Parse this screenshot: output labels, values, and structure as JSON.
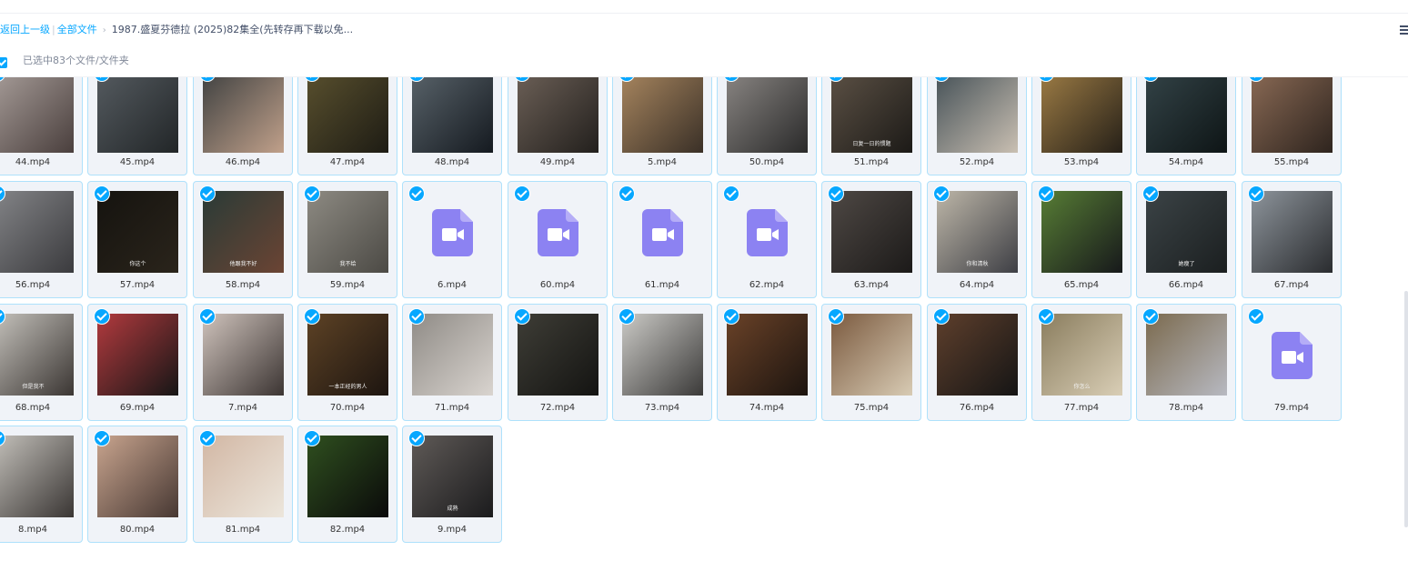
{
  "breadcrumb": {
    "back": "返回上一级",
    "all_files": "全部文件",
    "current": "1987.盛夏芬德拉 (2025)82集全(先转存再下载以免..."
  },
  "selection": {
    "text": "已选中83个文件/文件夹"
  },
  "icons": {
    "check": "check-icon",
    "video_file": "video-file-icon",
    "menu": "list-menu-icon"
  },
  "colors": {
    "accent": "#06a7ff",
    "card_bg": "#f0f3f8",
    "card_border": "#aee1fb",
    "video_icon": "#8c82f2"
  },
  "files": [
    {
      "name": "44.mp4",
      "type": "thumb",
      "colors": [
        "#a89e9a",
        "#4a3f3d"
      ]
    },
    {
      "name": "45.mp4",
      "type": "thumb",
      "colors": [
        "#555b60",
        "#222628"
      ]
    },
    {
      "name": "46.mp4",
      "type": "thumb",
      "colors": [
        "#3f4141",
        "#c0a08a"
      ]
    },
    {
      "name": "47.mp4",
      "type": "thumb",
      "colors": [
        "#59502e",
        "#1e1c14"
      ]
    },
    {
      "name": "48.mp4",
      "type": "thumb",
      "colors": [
        "#59636a",
        "#151a20"
      ]
    },
    {
      "name": "49.mp4",
      "type": "thumb",
      "colors": [
        "#6c6057",
        "#23201d"
      ]
    },
    {
      "name": "5.mp4",
      "type": "thumb",
      "colors": [
        "#a8865f",
        "#3a3027"
      ]
    },
    {
      "name": "50.mp4",
      "type": "thumb",
      "colors": [
        "#8a8683",
        "#2a2a2a"
      ]
    },
    {
      "name": "51.mp4",
      "type": "thumb",
      "colors": [
        "#5c5145",
        "#1c1a17"
      ],
      "subtitle": "日复一日的惯题"
    },
    {
      "name": "52.mp4",
      "type": "thumb",
      "colors": [
        "#455157",
        "#c9bfb2"
      ]
    },
    {
      "name": "53.mp4",
      "type": "thumb",
      "colors": [
        "#9d7c45",
        "#262018"
      ]
    },
    {
      "name": "54.mp4",
      "type": "thumb",
      "colors": [
        "#334347",
        "#0e1516"
      ]
    },
    {
      "name": "55.mp4",
      "type": "thumb",
      "colors": [
        "#8a6a55",
        "#2e241e"
      ]
    },
    {
      "name": "56.mp4",
      "type": "thumb",
      "colors": [
        "#848588",
        "#3b3b3e"
      ]
    },
    {
      "name": "57.mp4",
      "type": "thumb",
      "colors": [
        "#15130f",
        "#2a241b"
      ],
      "subtitle": "你这个"
    },
    {
      "name": "58.mp4",
      "type": "thumb",
      "colors": [
        "#2a3b36",
        "#6b4434"
      ],
      "subtitle": "他跟我不好"
    },
    {
      "name": "59.mp4",
      "type": "thumb",
      "colors": [
        "#8d8a82",
        "#4c4a45"
      ],
      "subtitle": "我不给"
    },
    {
      "name": "6.mp4",
      "type": "video"
    },
    {
      "name": "60.mp4",
      "type": "video"
    },
    {
      "name": "61.mp4",
      "type": "video"
    },
    {
      "name": "62.mp4",
      "type": "video"
    },
    {
      "name": "63.mp4",
      "type": "thumb",
      "colors": [
        "#4e4844",
        "#1c1a19"
      ]
    },
    {
      "name": "64.mp4",
      "type": "thumb",
      "colors": [
        "#bdb6a8",
        "#3e3f45"
      ],
      "subtitle": "你和清秋"
    },
    {
      "name": "65.mp4",
      "type": "thumb",
      "colors": [
        "#577d35",
        "#17191b"
      ]
    },
    {
      "name": "66.mp4",
      "type": "thumb",
      "colors": [
        "#3b4346",
        "#1b1f20"
      ],
      "subtitle": "她瘦了"
    },
    {
      "name": "67.mp4",
      "type": "thumb",
      "colors": [
        "#8d949b",
        "#2a2c2f"
      ]
    },
    {
      "name": "68.mp4",
      "type": "thumb",
      "colors": [
        "#c6c3bd",
        "#3b3633"
      ],
      "subtitle": "但是我不"
    },
    {
      "name": "69.mp4",
      "type": "thumb",
      "colors": [
        "#b23a3e",
        "#161616"
      ]
    },
    {
      "name": "7.mp4",
      "type": "thumb",
      "colors": [
        "#cfc3bc",
        "#3c3533"
      ]
    },
    {
      "name": "70.mp4",
      "type": "thumb",
      "colors": [
        "#5d4225",
        "#1d1510"
      ],
      "subtitle": "一本正经的男人"
    },
    {
      "name": "71.mp4",
      "type": "thumb",
      "colors": [
        "#8f8b86",
        "#d9d4cf"
      ]
    },
    {
      "name": "72.mp4",
      "type": "thumb",
      "colors": [
        "#3e3d36",
        "#141412"
      ]
    },
    {
      "name": "73.mp4",
      "type": "thumb",
      "colors": [
        "#cbcac6",
        "#3b3a39"
      ]
    },
    {
      "name": "74.mp4",
      "type": "thumb",
      "colors": [
        "#6a4228",
        "#1c140f"
      ]
    },
    {
      "name": "75.mp4",
      "type": "thumb",
      "colors": [
        "#7b5a3f",
        "#d8cbb4"
      ]
    },
    {
      "name": "76.mp4",
      "type": "thumb",
      "colors": [
        "#5e3f2c",
        "#151515"
      ]
    },
    {
      "name": "77.mp4",
      "type": "thumb",
      "colors": [
        "#8a7d5e",
        "#d9ceb6"
      ],
      "subtitle": "你怎么"
    },
    {
      "name": "78.mp4",
      "type": "thumb",
      "colors": [
        "#7b6a4e",
        "#b7b9c1"
      ]
    },
    {
      "name": "79.mp4",
      "type": "video"
    },
    {
      "name": "8.mp4",
      "type": "thumb",
      "colors": [
        "#c5c2bc",
        "#3a3634"
      ]
    },
    {
      "name": "80.mp4",
      "type": "thumb",
      "colors": [
        "#c8a48e",
        "#473833"
      ]
    },
    {
      "name": "81.mp4",
      "type": "thumb",
      "colors": [
        "#d2b7a4",
        "#ece6dc"
      ]
    },
    {
      "name": "82.mp4",
      "type": "thumb",
      "colors": [
        "#2f4f1f",
        "#0a0a0a"
      ]
    },
    {
      "name": "9.mp4",
      "type": "thumb",
      "colors": [
        "#5f5a57",
        "#1b1b1d"
      ],
      "subtitle": "成熟"
    }
  ]
}
